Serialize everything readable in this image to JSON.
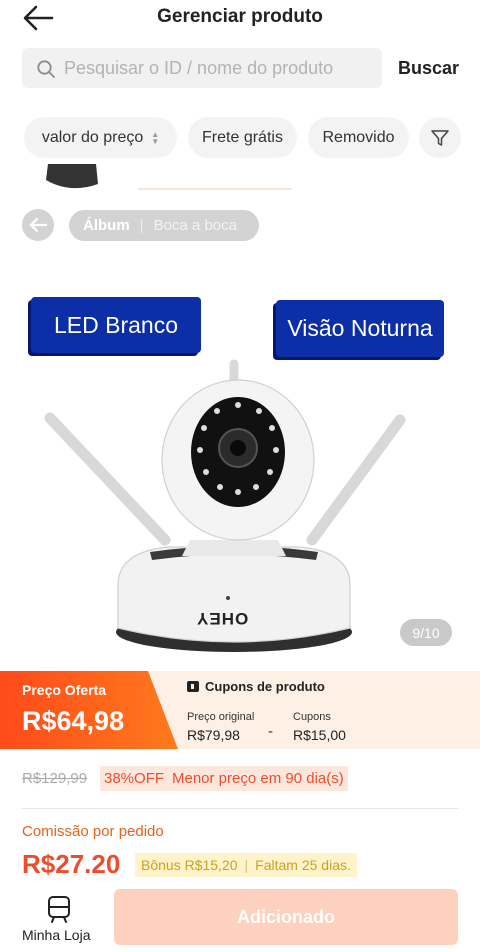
{
  "header": {
    "title": "Gerenciar produto"
  },
  "search": {
    "placeholder": "Pesquisar o ID / nome do produto",
    "button_label": "Buscar"
  },
  "filters": {
    "price_label": "valor do preço",
    "shipping_label": "Frete grátis",
    "removed_label": "Removido"
  },
  "gallery": {
    "album_label": "Álbum",
    "word_of_mouth_label": "Boca a boca",
    "badge_left": "LED Branco",
    "badge_right": "Visão Noturna",
    "brand_text": "OHEY",
    "counter": "9/10"
  },
  "price_banner": {
    "offer_label": "Preço Oferta",
    "offer_price": "R$64,98",
    "coupons_title": "Cupons de produto",
    "original_label": "Preço original",
    "original_value": "R$79,98",
    "dash": "-",
    "coupons_label": "Cupons",
    "coupons_value": "R$15,00"
  },
  "pricing": {
    "old_price": "R$129,99",
    "discount": "38%OFF",
    "lowest_price": "Menor preço em 90 dia(s)"
  },
  "commission": {
    "label": "Comissão por pedido",
    "value": "R$27.20",
    "bonus": "Bônus R$15,20",
    "remaining": "Faltam 25 dias."
  },
  "bottom_bar": {
    "store_label": "Minha Loja",
    "add_button": "Adicionado"
  },
  "colors": {
    "accent": "#ee4d2d",
    "badge_blue": "#0c2ea6",
    "banner_bg": "#fff0e6",
    "button_disabled": "#fdd1bd"
  }
}
